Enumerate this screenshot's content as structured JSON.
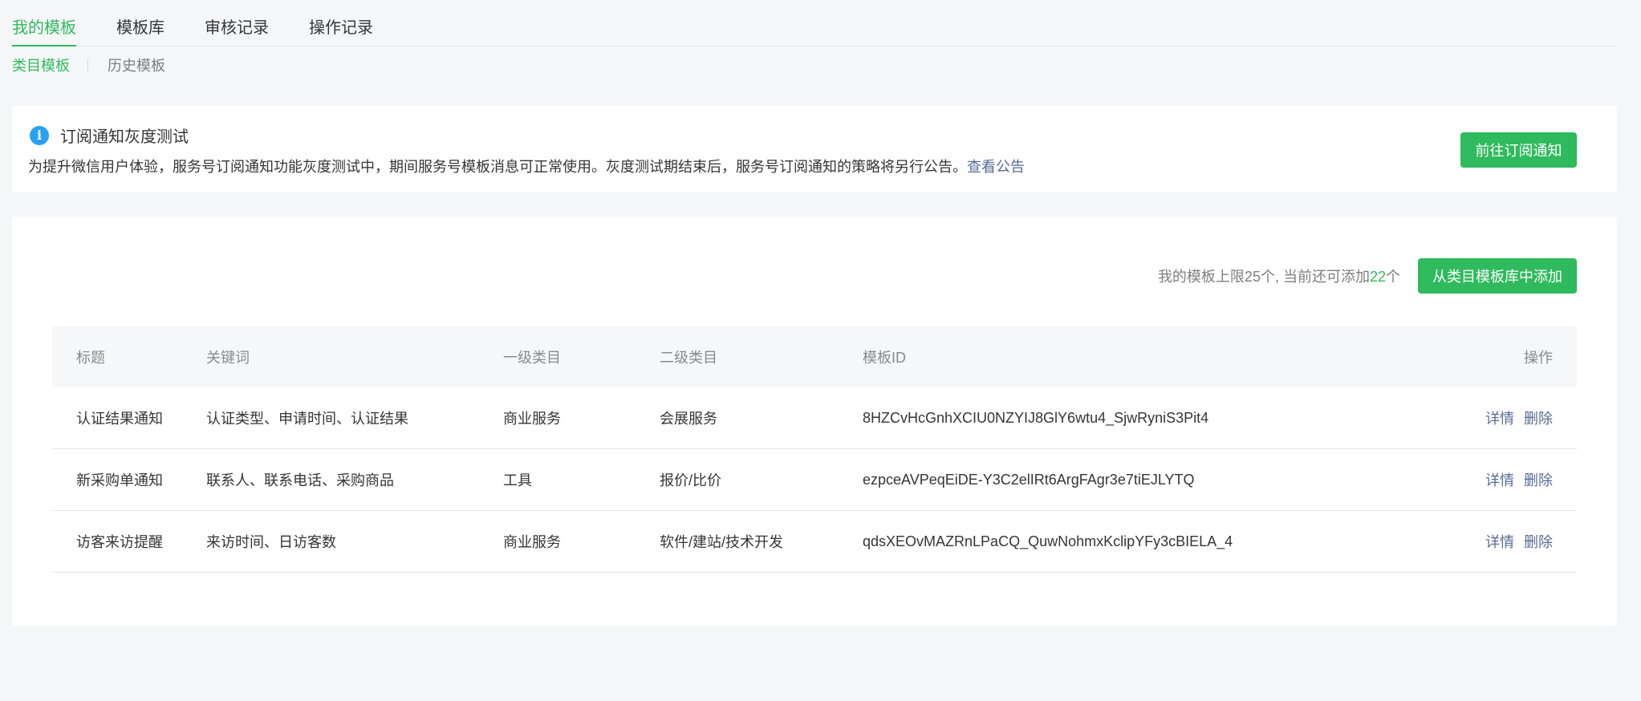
{
  "tabs": [
    {
      "label": "我的模板",
      "active": true
    },
    {
      "label": "模板库",
      "active": false
    },
    {
      "label": "审核记录",
      "active": false
    },
    {
      "label": "操作记录",
      "active": false
    }
  ],
  "subtabs": [
    {
      "label": "类目模板",
      "active": true
    },
    {
      "label": "历史模板",
      "active": false
    }
  ],
  "notice": {
    "icon": "info-icon",
    "icon_glyph": "i",
    "title": "订阅通知灰度测试",
    "desc": "为提升微信用户体验，服务号订阅通知功能灰度测试中，期间服务号模板消息可正常使用。灰度测试期结束后，服务号订阅通知的策略将另行公告。",
    "link": "查看公告",
    "button": "前往订阅通知"
  },
  "quota": {
    "prefix": "我的模板上限25个, 当前还可添加",
    "remaining": "22",
    "suffix": "个",
    "add_button": "从类目模板库中添加"
  },
  "table": {
    "headers": {
      "title": "标题",
      "keywords": "关键词",
      "cat1": "一级类目",
      "cat2": "二级类目",
      "id": "模板ID",
      "ops": "操作"
    },
    "rows": [
      {
        "title": "认证结果通知",
        "keywords": "认证类型、申请时间、认证结果",
        "cat1": "商业服务",
        "cat2": "会展服务",
        "id": "8HZCvHcGnhXCIU0NZYIJ8GlY6wtu4_SjwRyniS3Pit4",
        "detail": "详情",
        "delete": "删除"
      },
      {
        "title": "新采购单通知",
        "keywords": "联系人、联系电话、采购商品",
        "cat1": "工具",
        "cat2": "报价/比价",
        "id": "ezpceAVPeqEiDE-Y3C2elIRt6ArgFAgr3e7tiEJLYTQ",
        "detail": "详情",
        "delete": "删除"
      },
      {
        "title": "访客来访提醒",
        "keywords": "来访时间、日访客数",
        "cat1": "商业服务",
        "cat2": "软件/建站/技术开发",
        "id": "qdsXEOvMAZRnLPaCQ_QuwNohmxKclipYFy3cBIELA_4",
        "detail": "详情",
        "delete": "删除"
      }
    ]
  },
  "colors": {
    "accent": "#2fba5e",
    "link": "#576b95",
    "info": "#2aa1f0"
  }
}
